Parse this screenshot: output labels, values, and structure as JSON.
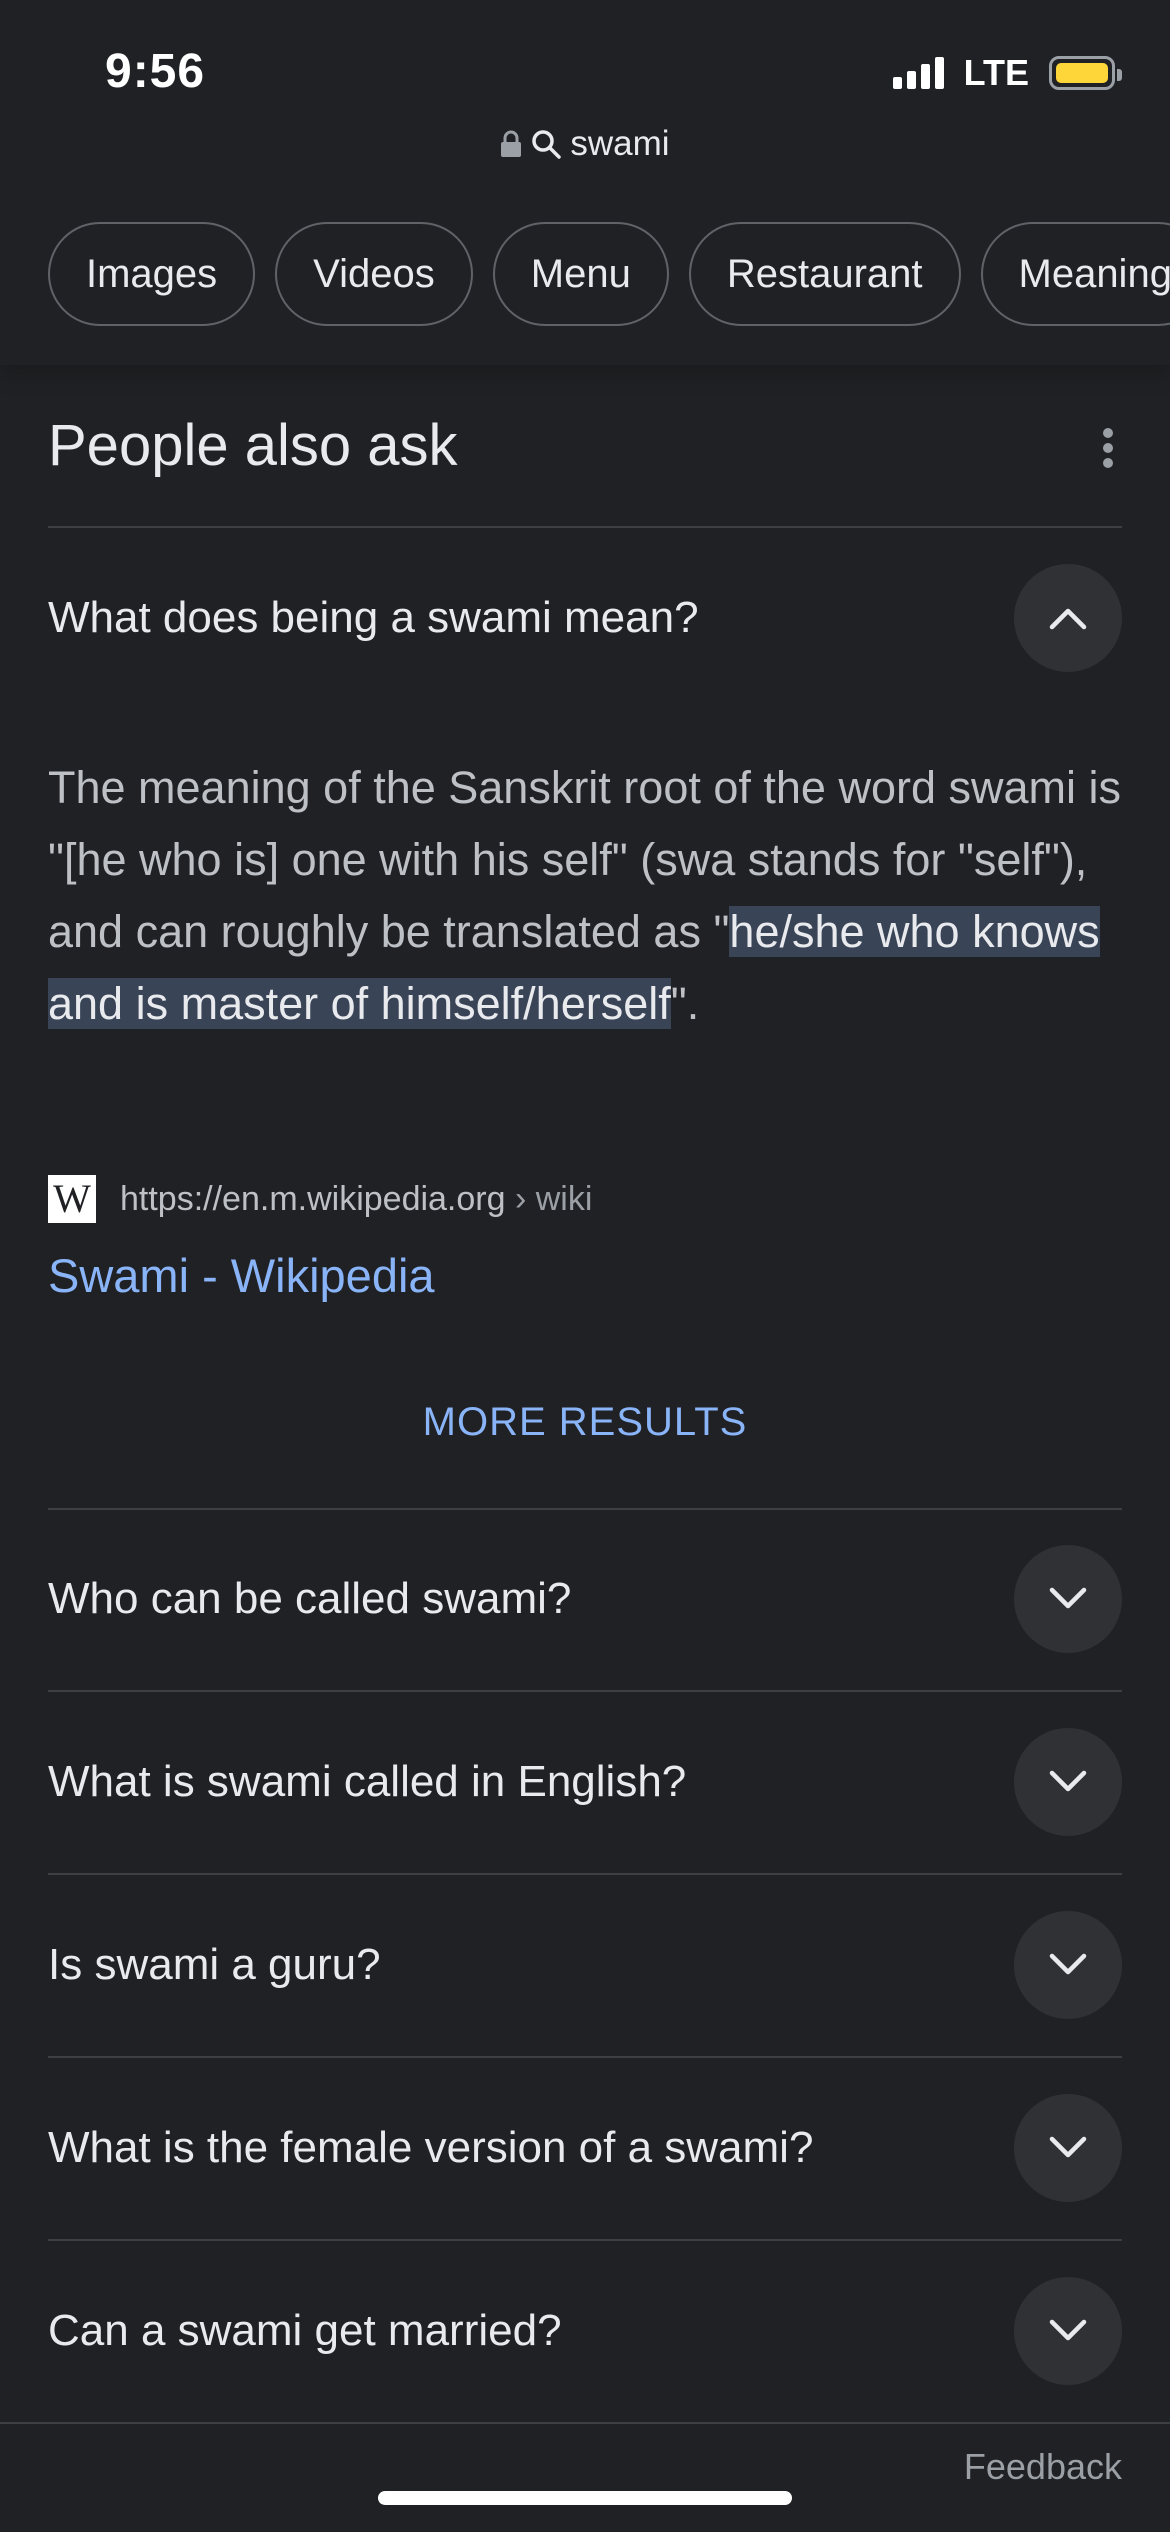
{
  "status_bar": {
    "time": "9:56",
    "network": "LTE",
    "battery_color": "#ffd63a"
  },
  "url_bar": {
    "query": "swami",
    "icons": [
      "lock-icon",
      "search-icon"
    ]
  },
  "chips": [
    "Images",
    "Videos",
    "Menu",
    "Restaurant",
    "Meaning"
  ],
  "paa": {
    "title": "People also ask",
    "expanded": {
      "question": "What does being a swami mean?",
      "answer_before": "The meaning of the Sanskrit root of the word swami is \"[he who is] one with his self\" (swa stands for \"self\"), and can roughly be translated as \"",
      "answer_highlight": "he/she who knows and is master of himself/herself",
      "answer_after": "\".",
      "source_domain": "https://en.m.wikipedia.org",
      "source_path": "› wiki",
      "source_title": "Swami - Wikipedia",
      "more_results": "MORE RESULTS"
    },
    "questions": [
      "Who can be called swami?",
      "What is swami called in English?",
      "Is swami a guru?",
      "What is the female version of a swami?",
      "Can a swami get married?"
    ]
  },
  "footer": {
    "feedback": "Feedback"
  },
  "colors": {
    "background": "#202124",
    "link": "#8ab4f8",
    "highlight": "#394457"
  }
}
